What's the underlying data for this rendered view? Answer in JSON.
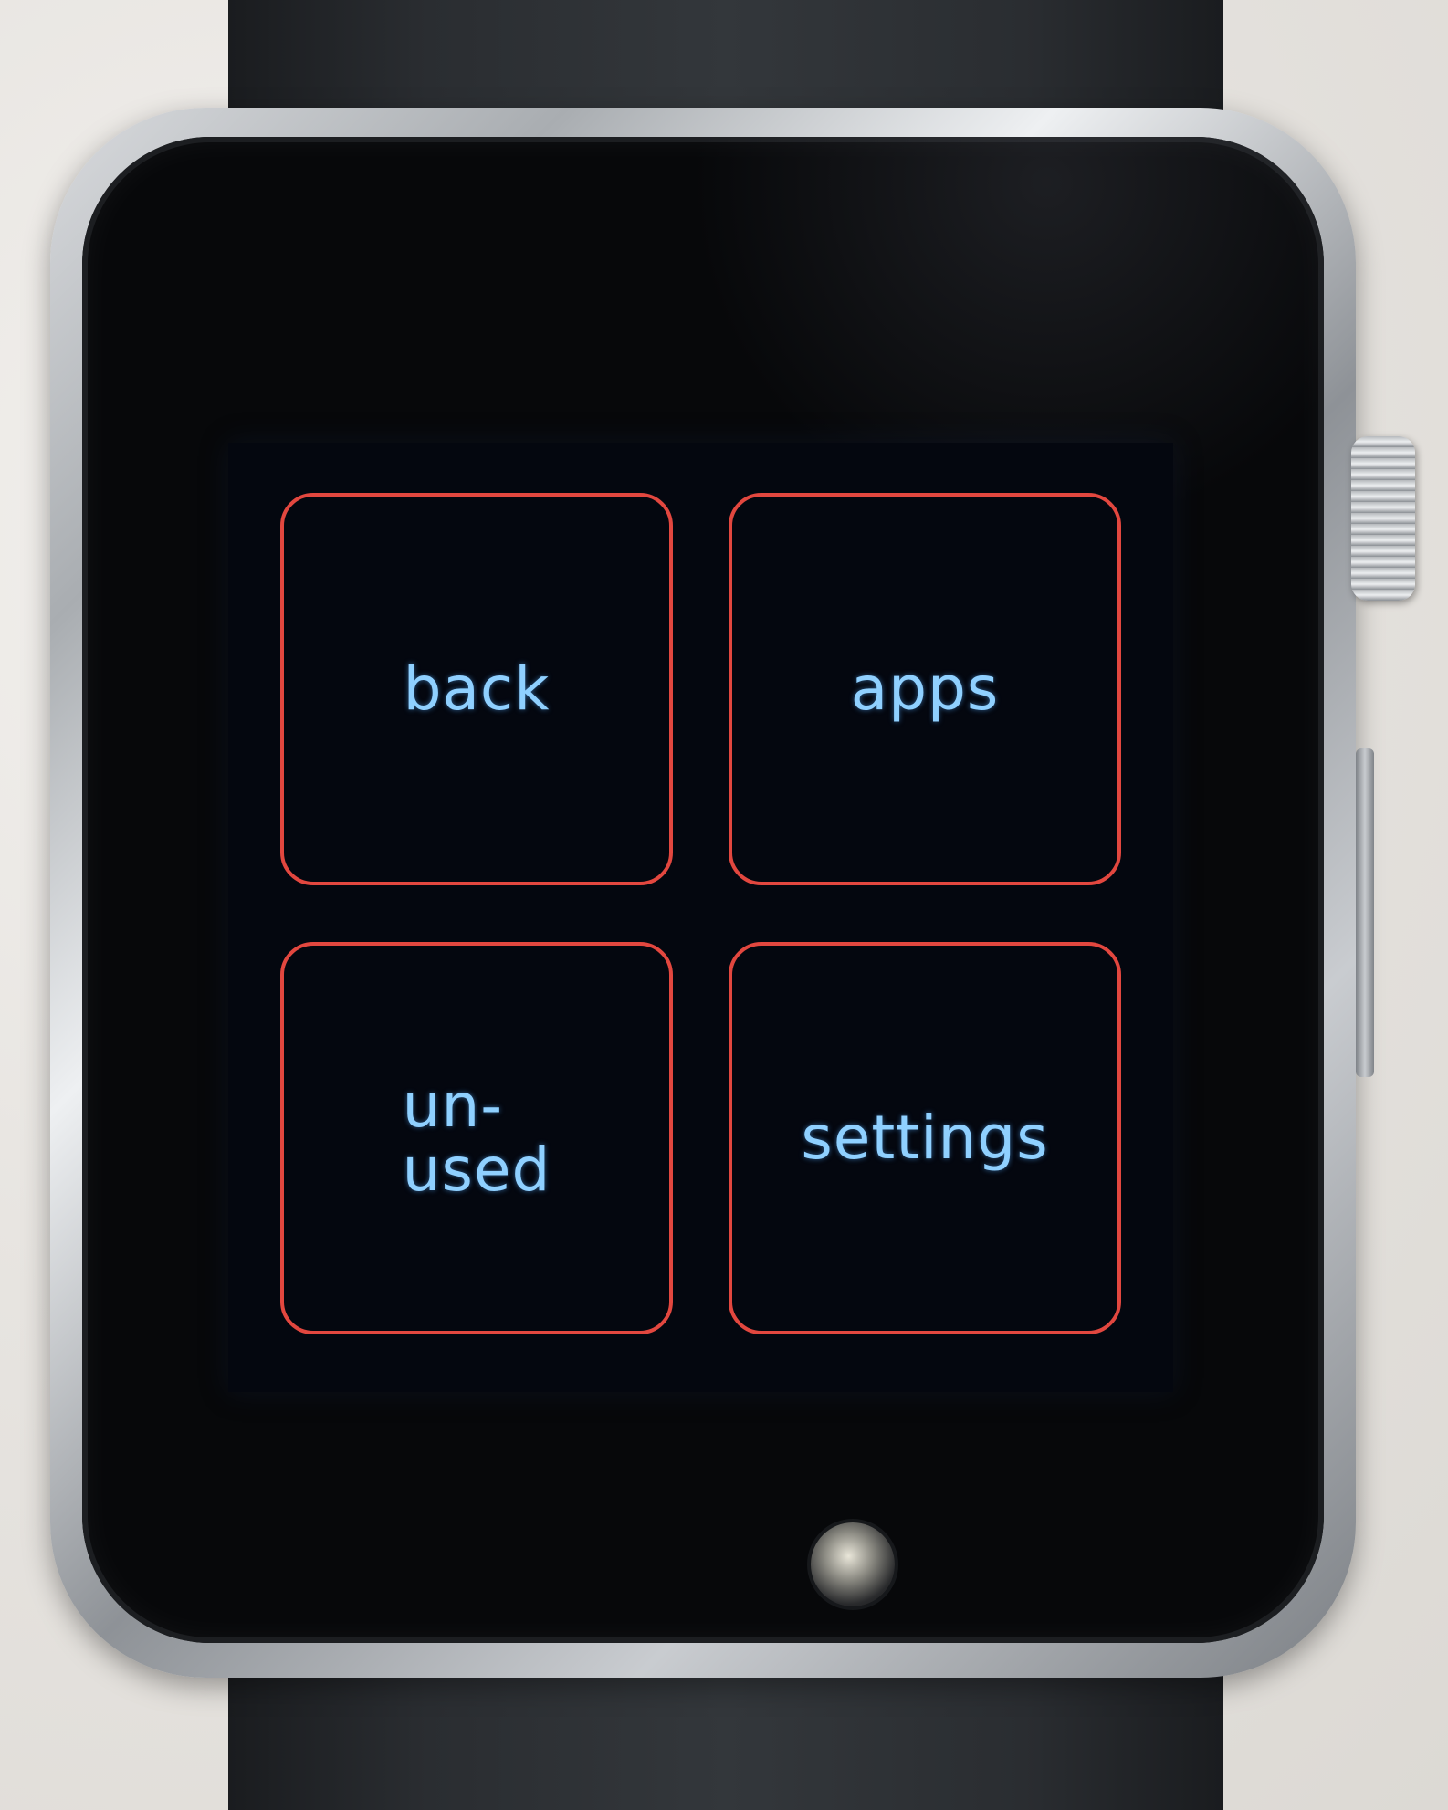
{
  "watch": {
    "accent_color": "#e2473f",
    "label_color": "#8fd0ff",
    "background_color": "#04070f"
  },
  "menu": {
    "tiles": [
      {
        "id": "back",
        "label": "back"
      },
      {
        "id": "apps",
        "label": "apps"
      },
      {
        "id": "unused",
        "label": "un-\nused"
      },
      {
        "id": "settings",
        "label": "settings"
      }
    ]
  }
}
